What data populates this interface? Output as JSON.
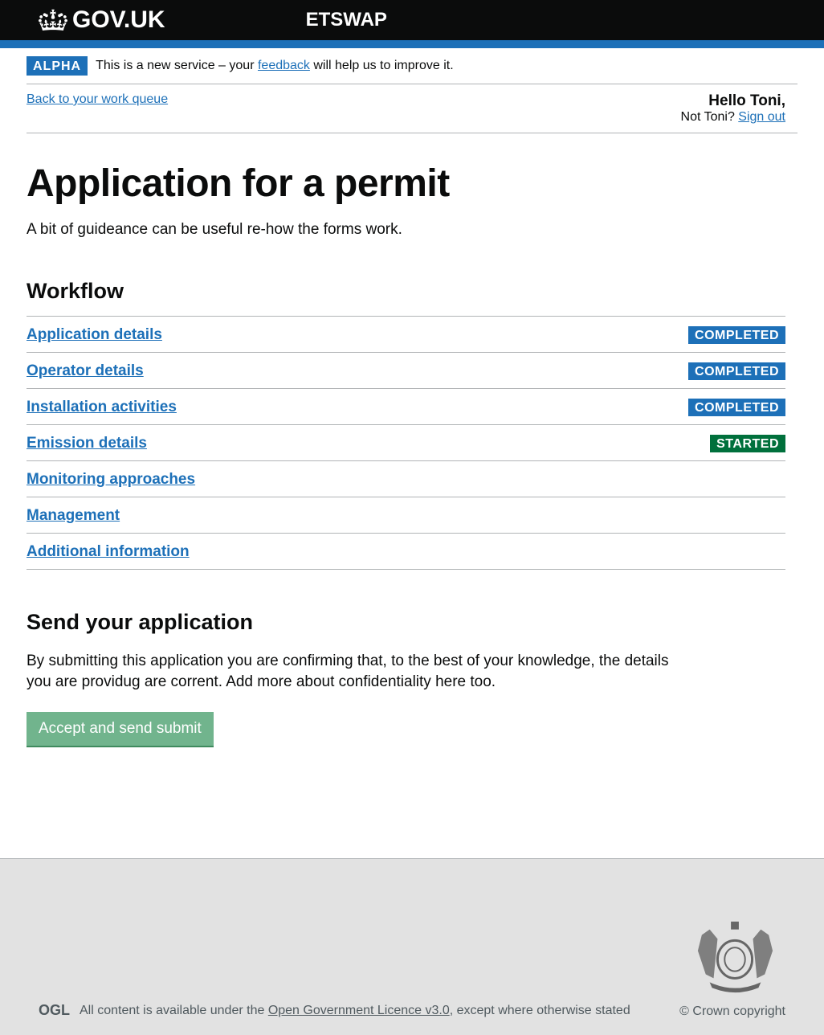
{
  "header": {
    "govuk": "GOV.UK",
    "service": "ETSWAP"
  },
  "phase": {
    "tag": "ALPHA",
    "pre": "This is a new service – your ",
    "link": "feedback",
    "post": " will help us to improve it."
  },
  "topbar": {
    "back": "Back to your work queue",
    "hello": "Hello Toni,",
    "not": "Not Toni? ",
    "signout": "Sign out"
  },
  "page": {
    "title": "Application for a permit",
    "subtitle": "A bit of guideance can be useful re-how the forms work."
  },
  "workflow": {
    "heading": "Workflow",
    "items": [
      {
        "label": "Application details",
        "status": "COMPLETED",
        "cls": "tag-completed"
      },
      {
        "label": "Operator details",
        "status": "COMPLETED",
        "cls": "tag-completed"
      },
      {
        "label": "Installation activities",
        "status": "COMPLETED",
        "cls": "tag-completed"
      },
      {
        "label": "Emission details",
        "status": "STARTED",
        "cls": "tag-started"
      },
      {
        "label": "Monitoring approaches",
        "status": "",
        "cls": ""
      },
      {
        "label": "Management",
        "status": "",
        "cls": ""
      },
      {
        "label": "Additional information",
        "status": "",
        "cls": ""
      }
    ]
  },
  "apply": {
    "heading": "Send your application",
    "text": "By submitting this application you are confirming that, to the best of your knowledge, the details you are providug are corrent. Add more about confidentiality here too.",
    "button": "Accept and send submit"
  },
  "footer": {
    "ogl": "OGL",
    "lic_pre": "All content is available under the ",
    "lic_link": "Open Government Licence v3.0",
    "lic_post": ", except where otherwise stated",
    "copyright": "© Crown copyright"
  }
}
